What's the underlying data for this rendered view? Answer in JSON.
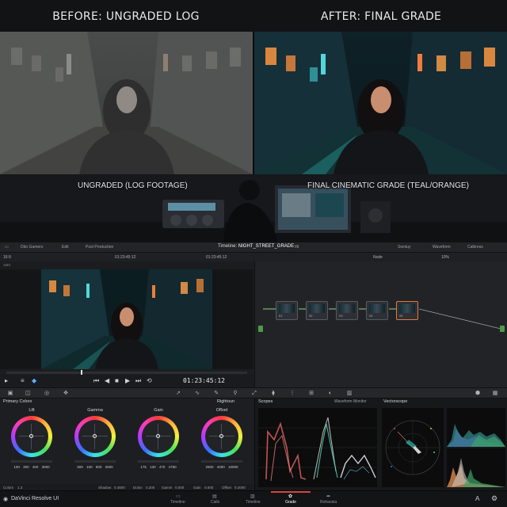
{
  "comparison": {
    "before_title": "BEFORE: UNGRADED LOG",
    "after_title": "AFTER: FINAL GRADE"
  },
  "band": {
    "left_label": "UNGRADED (LOG FOOTAGE)",
    "right_label": "FINAL CINEMATIC GRADE (TEAL/ORANGE)"
  },
  "pagebar": {
    "items": [
      "Dbn Gamers",
      "Edit",
      "Post Production"
    ],
    "timeline_prefix": "Timeline:",
    "timeline_name": "NIGHT_STREET_GRADE",
    "timeline_suffix": "Ifit",
    "right_items": [
      "Swotuy",
      "Waveform",
      "Calbress"
    ]
  },
  "viewer": {
    "aspect": "16:9",
    "timecode_left": "01:23:45:12",
    "timecode_right": "01:23:45:12",
    "sub_label": "16Kt",
    "main_timecode": "01:23:45:12"
  },
  "node_editor": {
    "label": "Node",
    "zoom": "10%",
    "node_labels": [
      "01",
      "02",
      "03",
      "04",
      "05"
    ]
  },
  "primary_colors": {
    "title": "Primary Colors",
    "mode": "Rightoun",
    "wheels": [
      {
        "name": "Lift",
        "values": [
          "100",
          "300",
          "400",
          "3000"
        ]
      },
      {
        "name": "Gamma",
        "values": [
          "500",
          "100",
          "600",
          "3000"
        ]
      },
      {
        "name": "Gain",
        "values": [
          "175",
          "130",
          "470",
          "4780"
        ]
      },
      {
        "name": "Offset",
        "values": [
          "2500",
          "4000",
          "10000"
        ]
      }
    ],
    "bottom": {
      "color_label": "Colors",
      "color_value": "1.3",
      "shadow_label": "Shadow",
      "shadow_value": "0.4500",
      "dolon_label": "Dolon",
      "dolon_value": "0.200",
      "gamm_label": "Gamm",
      "gamm_value": "0.000",
      "gain_label": "Gain",
      "gain_value": "0.000",
      "offset_label": "Offset",
      "offset_value": "0.2000"
    }
  },
  "scopes": {
    "title": "Scopes",
    "waveform_label": "Waveform Monitor",
    "vectorscope_label": "Vectorscope"
  },
  "statusbar": {
    "brand": "DaVinci Resolve UI",
    "tabs": [
      "Timeline",
      "Calls",
      "Timeline",
      "Grade",
      "Rohaosia"
    ],
    "active_index": 3
  },
  "colors": {
    "accent": "#d64545",
    "teal": "#2fb5b0",
    "orange": "#e07a3a"
  }
}
